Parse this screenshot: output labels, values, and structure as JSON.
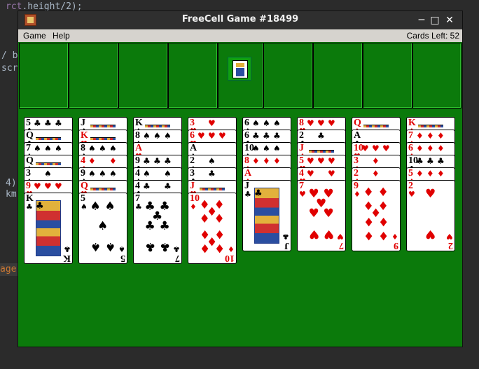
{
  "editor": {
    "lines": [
      {
        "text": "rct.height/2);",
        "hl": "rct",
        "kw": ""
      },
      {
        "text": "/ b",
        "hl": "",
        "kw": ""
      },
      {
        "text": "scr",
        "hl": "",
        "kw": ""
      },
      {
        "text": "4)",
        "hl": "",
        "kw": ""
      },
      {
        "text": "km",
        "hl": "",
        "kw": ""
      },
      {
        "text": "age",
        "hl": "",
        "kw": ""
      }
    ]
  },
  "window": {
    "title": "FreeCell Game #18499",
    "buttons": {
      "minimize": "─",
      "maximize": "□",
      "close": "✕"
    },
    "menu": {
      "game": "Game",
      "help": "Help"
    },
    "status": "Cards Left: 52"
  },
  "colors": {
    "felt": "#0b7a0b",
    "red": "#e00000",
    "black": "#000000"
  },
  "tableau": [
    [
      {
        "rank": "5",
        "suit": "♣",
        "color": "black"
      },
      {
        "rank": "Q",
        "suit": "♣",
        "color": "black"
      },
      {
        "rank": "7",
        "suit": "♠",
        "color": "black"
      },
      {
        "rank": "Q",
        "suit": "♠",
        "color": "black"
      },
      {
        "rank": "3",
        "suit": "♠",
        "color": "black"
      },
      {
        "rank": "9",
        "suit": "♥",
        "color": "red"
      },
      {
        "rank": "K",
        "suit": "♣",
        "color": "black"
      }
    ],
    [
      {
        "rank": "J",
        "suit": "♠",
        "color": "black"
      },
      {
        "rank": "K",
        "suit": "♥",
        "color": "red"
      },
      {
        "rank": "8",
        "suit": "♠",
        "color": "black"
      },
      {
        "rank": "4",
        "suit": "♦",
        "color": "red"
      },
      {
        "rank": "9",
        "suit": "♠",
        "color": "black"
      },
      {
        "rank": "Q",
        "suit": "♥",
        "color": "red"
      },
      {
        "rank": "5",
        "suit": "♠",
        "color": "black"
      }
    ],
    [
      {
        "rank": "K",
        "suit": "♠",
        "color": "black"
      },
      {
        "rank": "8",
        "suit": "♠",
        "color": "black"
      },
      {
        "rank": "A",
        "suit": "♥",
        "color": "red"
      },
      {
        "rank": "9",
        "suit": "♣",
        "color": "black"
      },
      {
        "rank": "4",
        "suit": "♠",
        "color": "black"
      },
      {
        "rank": "4",
        "suit": "♣",
        "color": "black"
      },
      {
        "rank": "7",
        "suit": "♣",
        "color": "black"
      }
    ],
    [
      {
        "rank": "3",
        "suit": "♥",
        "color": "red"
      },
      {
        "rank": "6",
        "suit": "♥",
        "color": "red"
      },
      {
        "rank": "A",
        "suit": "♠",
        "color": "black"
      },
      {
        "rank": "2",
        "suit": "♠",
        "color": "black"
      },
      {
        "rank": "3",
        "suit": "♣",
        "color": "black"
      },
      {
        "rank": "J",
        "suit": "♥",
        "color": "red"
      },
      {
        "rank": "10",
        "suit": "♦",
        "color": "red"
      }
    ],
    [
      {
        "rank": "6",
        "suit": "♠",
        "color": "black"
      },
      {
        "rank": "6",
        "suit": "♣",
        "color": "black"
      },
      {
        "rank": "10",
        "suit": "♠",
        "color": "black"
      },
      {
        "rank": "8",
        "suit": "♦",
        "color": "red"
      },
      {
        "rank": "A",
        "suit": "♦",
        "color": "red"
      },
      {
        "rank": "J",
        "suit": "♣",
        "color": "black"
      }
    ],
    [
      {
        "rank": "8",
        "suit": "♥",
        "color": "red"
      },
      {
        "rank": "2",
        "suit": "♣",
        "color": "black"
      },
      {
        "rank": "J",
        "suit": "♦",
        "color": "red"
      },
      {
        "rank": "5",
        "suit": "♥",
        "color": "red"
      },
      {
        "rank": "4",
        "suit": "♥",
        "color": "red"
      },
      {
        "rank": "7",
        "suit": "♥",
        "color": "red"
      }
    ],
    [
      {
        "rank": "Q",
        "suit": "♦",
        "color": "red"
      },
      {
        "rank": "A",
        "suit": "♣",
        "color": "black"
      },
      {
        "rank": "10",
        "suit": "♥",
        "color": "red"
      },
      {
        "rank": "3",
        "suit": "♦",
        "color": "red"
      },
      {
        "rank": "2",
        "suit": "♦",
        "color": "red"
      },
      {
        "rank": "9",
        "suit": "♦",
        "color": "red"
      }
    ],
    [
      {
        "rank": "K",
        "suit": "♦",
        "color": "red"
      },
      {
        "rank": "7",
        "suit": "♦",
        "color": "red"
      },
      {
        "rank": "6",
        "suit": "♦",
        "color": "red"
      },
      {
        "rank": "10",
        "suit": "♣",
        "color": "black"
      },
      {
        "rank": "5",
        "suit": "♦",
        "color": "red"
      },
      {
        "rank": "2",
        "suit": "♥",
        "color": "red"
      }
    ]
  ]
}
